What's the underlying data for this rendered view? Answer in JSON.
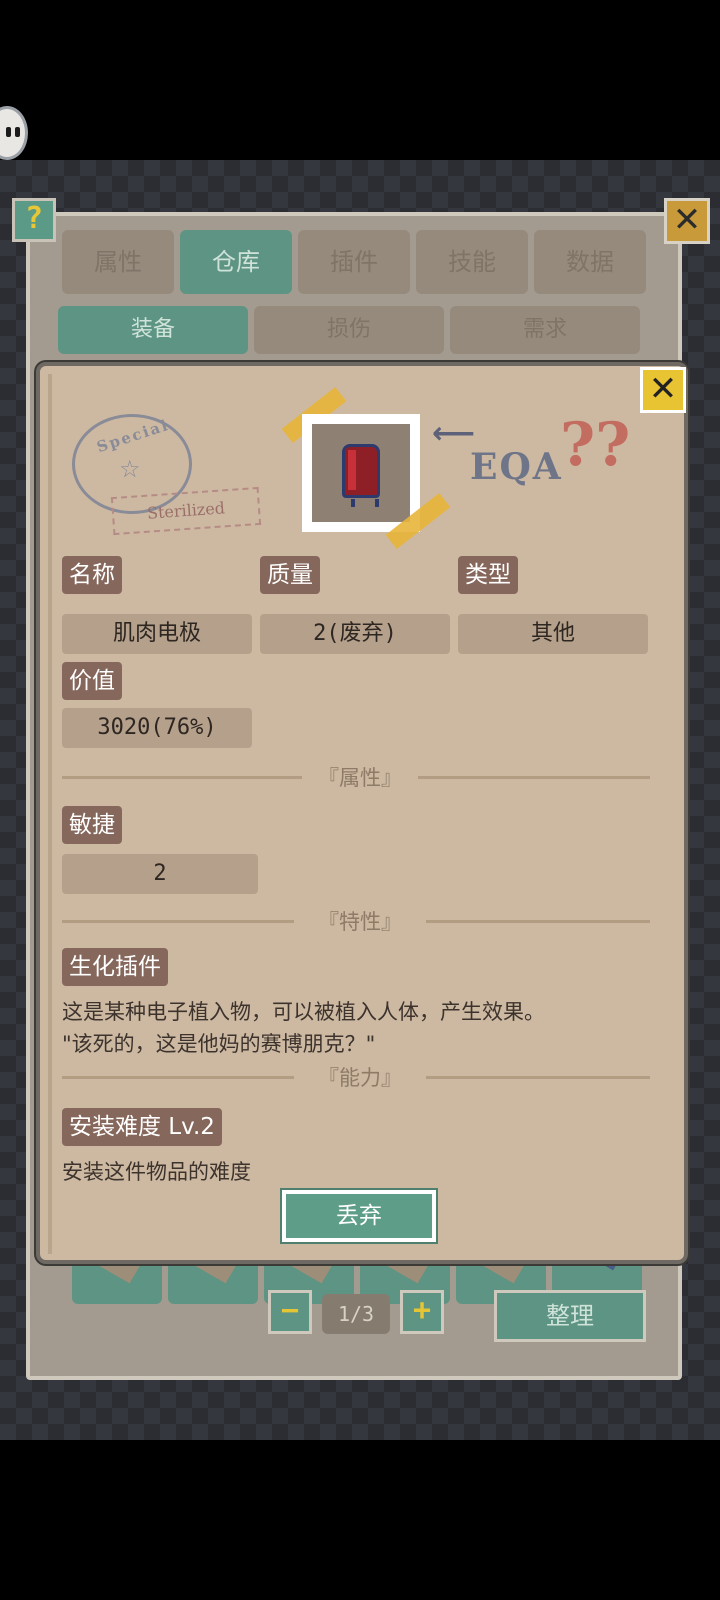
{
  "tabs": [
    {
      "label": "属性",
      "active": false
    },
    {
      "label": "仓库",
      "active": true
    },
    {
      "label": "插件",
      "active": false
    },
    {
      "label": "技能",
      "active": false
    },
    {
      "label": "数据",
      "active": false
    }
  ],
  "subtabs": [
    {
      "label": "装备",
      "active": true
    },
    {
      "label": "损伤",
      "active": false
    },
    {
      "label": "需求",
      "active": false
    }
  ],
  "help_icon": "?",
  "close_icon": "✕",
  "item": {
    "stamp_text": "Special",
    "stamp_label": "Sterilized",
    "sticker_text": "EQA",
    "qmarks": "??",
    "fields": {
      "name_label": "名称",
      "name_value": "肌肉电极",
      "quality_label": "质量",
      "quality_value": "2(废弃)",
      "type_label": "类型",
      "type_value": "其他",
      "value_label": "价值",
      "value_value": "3020(76%)"
    },
    "sections": {
      "attributes_title": "『属性』",
      "traits_title": "『特性』",
      "abilities_title": "『能力』"
    },
    "attribute": {
      "label": "敏捷",
      "value": "2"
    },
    "trait": {
      "label": "生化插件",
      "desc_line1": "这是某种电子植入物，可以被植入人体，产生效果。",
      "desc_line2": "\"该死的，这是他妈的赛博朋克？\""
    },
    "ability": {
      "label": "安装难度 Lv.2",
      "desc": "安装这件物品的难度"
    },
    "discard_label": "丢弃"
  },
  "pager": {
    "minus": "−",
    "plus": "+",
    "label": "1/3"
  },
  "sort_label": "整理",
  "colors": {
    "accent_green": "#5e9483",
    "popup_bg": "#cdb9a2",
    "chip_bg": "#86675c",
    "close_yellow": "#e8c332"
  }
}
